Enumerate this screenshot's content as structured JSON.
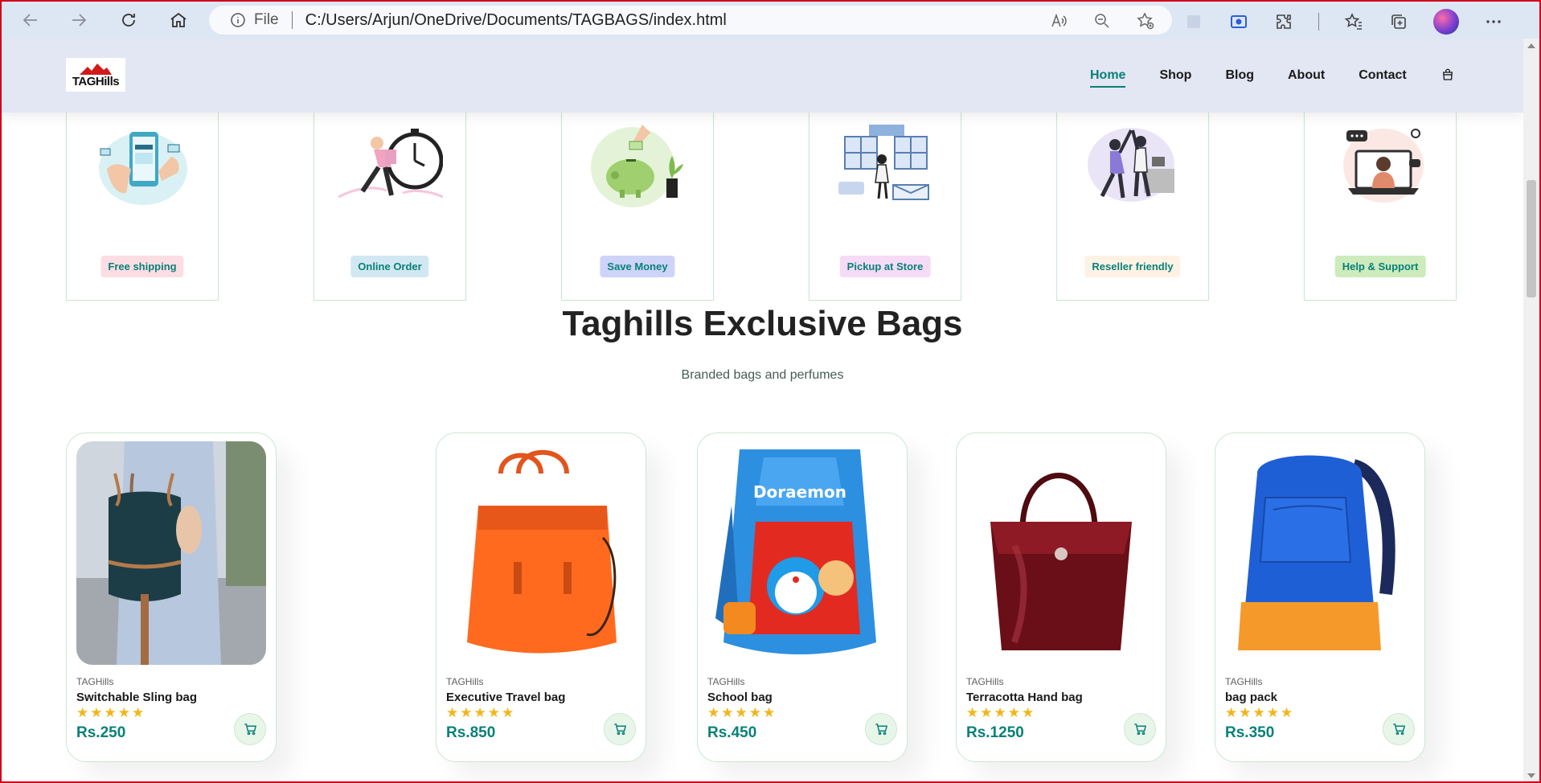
{
  "browser": {
    "info_label": "File",
    "url": "C:/Users/Arjun/OneDrive/Documents/TAGBAGS/index.html"
  },
  "site": {
    "logo_text": "TAGHills",
    "nav": [
      {
        "label": "Home",
        "active": true
      },
      {
        "label": "Shop",
        "active": false
      },
      {
        "label": "Blog",
        "active": false
      },
      {
        "label": "About",
        "active": false
      },
      {
        "label": "Contact",
        "active": false
      }
    ]
  },
  "features": [
    {
      "label": "Free shipping",
      "bg": "#fddde4",
      "icon": "phone-shopping-illustration"
    },
    {
      "label": "Online Order",
      "bg": "#cdebbc",
      "icon": "delivery-clock-illustration"
    },
    {
      "label": "Save Money",
      "bg": "#d1e8f2",
      "icon": "piggy-bank-illustration"
    },
    {
      "label": "Pickup at Store",
      "bg": "#cdd4f8",
      "icon": "store-pickup-illustration"
    },
    {
      "label": "Reseller friendly",
      "bg": "#f6dbf6",
      "icon": "high-five-illustration"
    },
    {
      "label": "Help & Support",
      "bg": "#fff2e5",
      "icon": "support-laptop-illustration"
    }
  ],
  "section": {
    "title": "Taghills Exclusive Bags",
    "subtitle": "Branded bags and perfumes"
  },
  "products": [
    {
      "brand": "TAGHills",
      "name": "Switchable Sling bag",
      "stars": "★★★★★",
      "rating": 5,
      "price": "Rs.250"
    },
    {
      "brand": "TAGHills",
      "name": "Executive Travel bag",
      "stars": "★★★★★",
      "rating": 5,
      "price": "Rs.850"
    },
    {
      "brand": "TAGHills",
      "name": "School bag",
      "stars": "★★★★★",
      "rating": 5,
      "price": "Rs.450"
    },
    {
      "brand": "TAGHills",
      "name": "Terracotta Hand bag",
      "stars": "★★★★★",
      "rating": 5,
      "price": "Rs.1250"
    },
    {
      "brand": "TAGHills",
      "name": "bag pack",
      "stars": "★★★★★",
      "rating": 5,
      "price": "Rs.350"
    }
  ],
  "colors": {
    "accent": "#088178",
    "star": "#f3b519"
  }
}
